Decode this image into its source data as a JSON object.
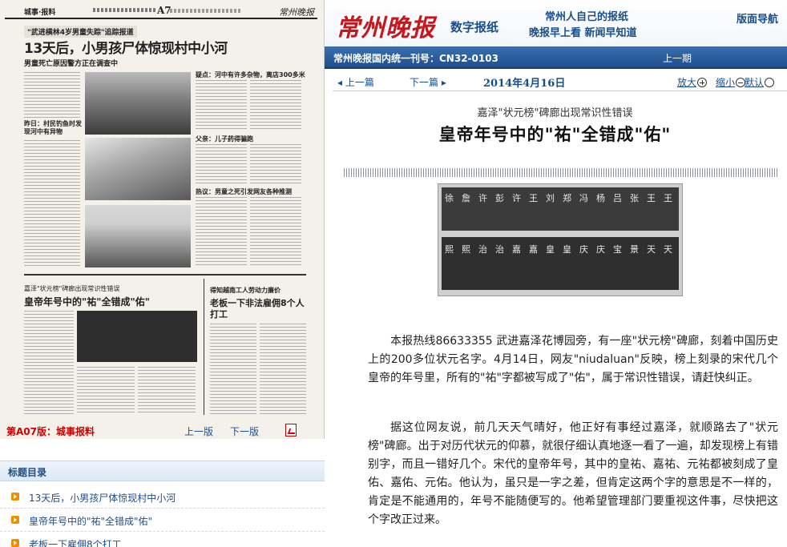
{
  "newspaper_page": {
    "header_section": "城事·报料",
    "page_number": "A7",
    "header_logo": "常州晚报",
    "top_tag": "\"武进横林4岁男童失踪\"追踪报道",
    "main_headline": "13天后，小男孩尸体惊现村中小河",
    "main_subhead": "男童死亡原因警方正在调查中",
    "side_heading_1": "昨日：村民钓鱼时发现河中有异物",
    "side_heading_2": "疑点：河中有许多杂物，离店300多米",
    "side_heading_3": "父亲：儿子药得骗跑",
    "side_heading_4": "热议：男童之死引发网友各种推测",
    "lower_tag": "嘉泽\"状元榜\"碑廊出现常识性错误",
    "lower_headline": "皇帝年号中的\"祐\"全错成\"佑\"",
    "right_tag": "得知越南工人劳动力廉价",
    "right_headline": "老板一下非法雇佣8个人打工",
    "footer_current": "第A07版：城事报料",
    "footer_prev": "上一版",
    "footer_next": "下一版"
  },
  "toc": {
    "title": "标题目录",
    "items": [
      "13天后，小男孩尸体惊现村中小河",
      "皇帝年号中的\"祐\"全错成\"佑\"",
      "老板一下雇佣8个打工"
    ]
  },
  "banner": {
    "brand": "常州晚报",
    "subtitle": "数字报纸",
    "slogan_1": "常州人自己的报纸",
    "slogan_2": "晚报早上看 新闻早知道",
    "nav": "版面导航"
  },
  "bluebar": {
    "cn_number": "常州晚报国内统一刊号：CN32-0103",
    "prev_issue": "上一期"
  },
  "article_nav": {
    "prev": "上一篇",
    "next": "下一篇",
    "date": "2014年4月16日",
    "zoom_in": "放大",
    "zoom_out": "缩小",
    "default": "默认"
  },
  "article": {
    "kicker": "嘉泽\"状元榜\"碑廊出现常识性错误",
    "headline": "皇帝年号中的\"祐\"全错成\"佑\"",
    "figure_row1": [
      "徐",
      "詹",
      "许",
      "彭",
      "许",
      "王",
      "刘",
      "郑",
      "冯",
      "杨",
      "吕",
      "张",
      "王",
      "王"
    ],
    "figure_row2": [
      "熙",
      "熙",
      "治",
      "治",
      "嘉",
      "嘉",
      "皇",
      "皇",
      "庆",
      "庆",
      "宝",
      "景",
      "天",
      "天"
    ],
    "paragraph_1": "本报热线86633355 武进嘉泽花博园旁，有一座\"状元榜\"碑廊，刻着中国历史上的200多位状元名字。4月14日，网友\"niudaluan\"反映，榜上刻录的宋代几个皇帝的年号里，所有的\"祐\"字都被写成了\"佑\"，属于常识性错误，请赶快纠正。",
    "paragraph_2": "据这位网友说，前几天天气晴好，他正好有事经过嘉泽，就顺路去了\"状元榜\"碑廊。出于对历代状元的仰慕，就很仔细认真地逐一看了一遍，却发现榜上有错别字，而且一错好几个。宋代的皇帝年号，其中的皇祐、嘉祐、元祐都被刻成了皇佑、嘉佑、元佑。他认为，虽只是一字之差，但肯定这两个字的意思是不一样的，肯定是不能通用的，年号不能随便写的。他希望管理部门要重视这件事，尽快把这个字改正过来。"
  },
  "colors": {
    "brand_red": "#c8161d",
    "nav_blue": "#1d4e8c",
    "bar_blue": "#1e4f8f",
    "toc_bullet": "#f08c00"
  }
}
